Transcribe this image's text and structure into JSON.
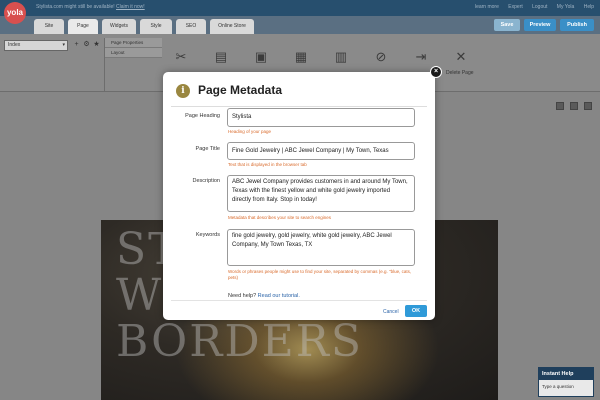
{
  "topbar": {
    "logo": "yola",
    "promo_text": "Stylista.com might still be available!",
    "promo_link": "Claim it now!",
    "links": [
      "learn more",
      "Expert",
      "Logout",
      "My Yola",
      "Help"
    ]
  },
  "tabs": [
    "Site",
    "Page",
    "Widgets",
    "Style",
    "SEO",
    "Online Store"
  ],
  "header_buttons": {
    "save": "Save",
    "preview": "Preview",
    "publish": "Publish"
  },
  "toolbar": {
    "page_select": "Index",
    "properties": [
      "Page Properties",
      "Layout"
    ],
    "delete_label": "Delete Page"
  },
  "modal": {
    "title": "Page Metadata",
    "fields": [
      {
        "label": "Page Heading",
        "value": "Stylista",
        "hint": "Heading of your page"
      },
      {
        "label": "Page Title",
        "value": "Fine Gold Jewelry | ABC Jewel Company | My Town, Texas",
        "hint": "Text that is displayed in the browser tab"
      },
      {
        "label": "Description",
        "value": "ABC Jewel Company provides customers in and around My Town, Texas with the finest yellow and white gold jewelry imported directly from Italy. Stop in today!",
        "hint": "Metadata that describes your site to search engines"
      },
      {
        "label": "Keywords",
        "value": "fine gold jewelry, gold jewelry, white gold jewelry, ABC Jewel Company, My Town Texas, TX",
        "hint": "Words or phrases people might use to find your site, separated by commas (e.g. \"blue, cats, pets)"
      }
    ],
    "need_help": "Need help?",
    "tutorial_link": "Read our tutorial.",
    "cancel": "Cancel",
    "ok": "OK"
  },
  "canvas": {
    "hero_text": [
      "ST",
      "W",
      "BORDERS"
    ]
  },
  "instant_help": {
    "title": "Instant Help",
    "question": "Type a question"
  },
  "colors": {
    "topbar": "#274f6e",
    "accent_ok": "#2f9ad8",
    "hint": "#d96a2b",
    "logo": "#d8504f"
  }
}
